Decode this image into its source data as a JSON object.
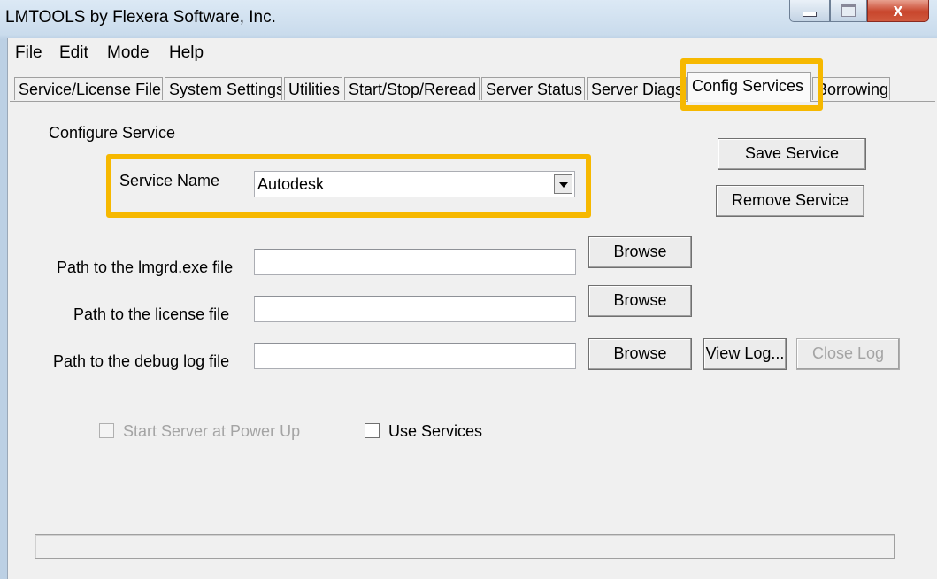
{
  "window": {
    "title": "LMTOOLS by Flexera Software, Inc.",
    "close_glyph": "x"
  },
  "menu": {
    "items": [
      "File",
      "Edit",
      "Mode",
      "Help"
    ]
  },
  "tabs": [
    "Service/License File",
    "System Settings",
    "Utilities",
    "Start/Stop/Reread",
    "Server Status",
    "Server Diags",
    "Config Services",
    "Borrowing"
  ],
  "active_tab": "Config Services",
  "config": {
    "section_title": "Configure Service",
    "service_name_label": "Service Name",
    "service_name_value": "Autodesk",
    "save_service": "Save Service",
    "remove_service": "Remove Service",
    "lmgrd_label": "Path to the lmgrd.exe file",
    "lmgrd_value": "",
    "license_label": "Path to the license file",
    "license_value": "",
    "debug_label": "Path to the debug log file",
    "debug_value": "",
    "browse": "Browse",
    "view_log": "View Log...",
    "close_log": "Close Log",
    "start_at_powerup": "Start Server at Power Up",
    "use_services": "Use Services"
  },
  "highlight_color": "#f6b800"
}
